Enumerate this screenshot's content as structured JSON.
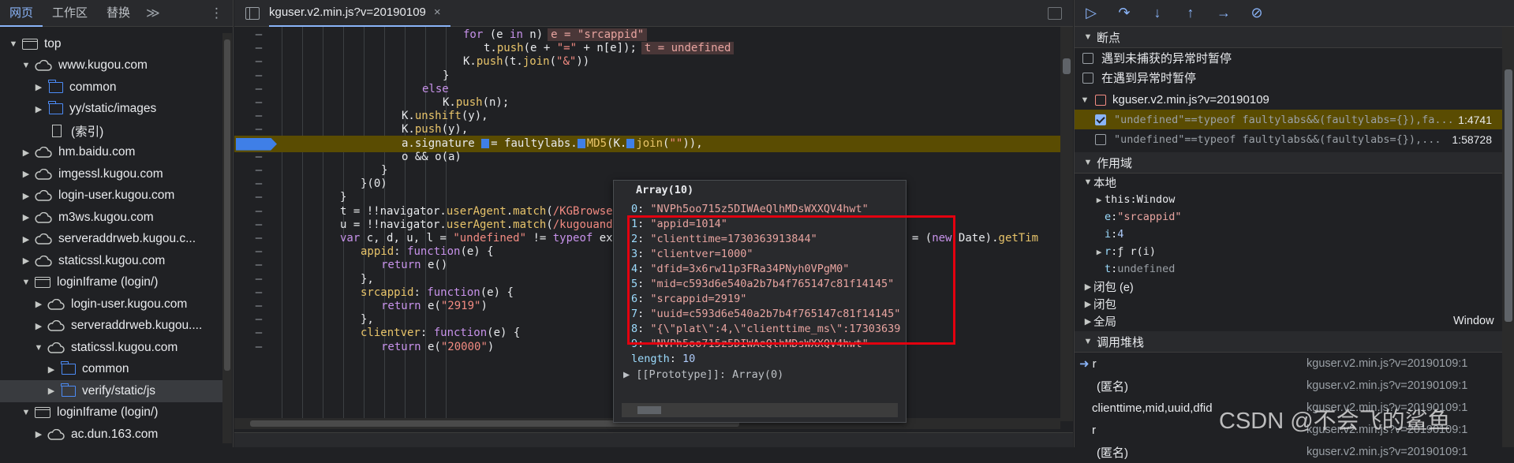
{
  "left_panel": {
    "tabs": [
      "网页",
      "工作区",
      "替换"
    ],
    "more_label": "≫",
    "menu_label": "⋮",
    "tree": [
      {
        "label": "top",
        "icon": "frame",
        "arrow": "▼",
        "depth": 0
      },
      {
        "label": "www.kugou.com",
        "icon": "cloud",
        "arrow": "▼",
        "depth": 1
      },
      {
        "label": "common",
        "icon": "folder",
        "arrow": "▶",
        "depth": 2
      },
      {
        "label": "yy/static/images",
        "icon": "folder",
        "arrow": "▶",
        "depth": 2
      },
      {
        "label": "(索引)",
        "icon": "file",
        "arrow": "",
        "depth": 2
      },
      {
        "label": "hm.baidu.com",
        "icon": "cloud",
        "arrow": "▶",
        "depth": 1
      },
      {
        "label": "imgessl.kugou.com",
        "icon": "cloud",
        "arrow": "▶",
        "depth": 1
      },
      {
        "label": "login-user.kugou.com",
        "icon": "cloud",
        "arrow": "▶",
        "depth": 1
      },
      {
        "label": "m3ws.kugou.com",
        "icon": "cloud",
        "arrow": "▶",
        "depth": 1
      },
      {
        "label": "serveraddrweb.kugou.c...",
        "icon": "cloud",
        "arrow": "▶",
        "depth": 1
      },
      {
        "label": "staticssl.kugou.com",
        "icon": "cloud",
        "arrow": "▶",
        "depth": 1
      },
      {
        "label": "loginIframe (login/)",
        "icon": "frame",
        "arrow": "▼",
        "depth": 1
      },
      {
        "label": "login-user.kugou.com",
        "icon": "cloud",
        "arrow": "▶",
        "depth": 2
      },
      {
        "label": "serveraddrweb.kugou....",
        "icon": "cloud",
        "arrow": "▶",
        "depth": 2
      },
      {
        "label": "staticssl.kugou.com",
        "icon": "cloud",
        "arrow": "▼",
        "depth": 2
      },
      {
        "label": "common",
        "icon": "folder",
        "arrow": "▶",
        "depth": 3
      },
      {
        "label": "verify/static/js",
        "icon": "folder",
        "arrow": "▶",
        "depth": 3,
        "selected": true
      },
      {
        "label": "loginIframe (login/)",
        "icon": "frame",
        "arrow": "▼",
        "depth": 1
      },
      {
        "label": "ac.dun.163.com",
        "icon": "cloud",
        "arrow": "▶",
        "depth": 2
      }
    ]
  },
  "editor": {
    "file_tab": "kguser.v2.min.js?v=20190109",
    "close_label": "×",
    "lines": [
      {
        "gutter": "–",
        "indent": 270,
        "html": "<span class='kw'>for</span> (e <span class='kw'>in</span> n)<span class='inl'>e = \"srcappid\"</span>"
      },
      {
        "gutter": "–",
        "indent": 296,
        "html": "t.<span class='prop'>push</span>(e + <span class='str'>\"=\"</span> + n[e]);<span class='inl'>t = undefined</span>"
      },
      {
        "gutter": "–",
        "indent": 270,
        "html": "K.<span class='prop'>push</span>(t.<span class='prop'>join</span>(<span class='str'>\"&amp;\"</span>))"
      },
      {
        "gutter": "–",
        "indent": 244,
        "html": "}"
      },
      {
        "gutter": "–",
        "indent": 218,
        "html": "<span class='kw'>else</span>"
      },
      {
        "gutter": "–",
        "indent": 244,
        "html": "K.<span class='prop'>push</span>(n);"
      },
      {
        "gutter": "–",
        "indent": 192,
        "html": "K.<span class='prop'>unshift</span>(y),"
      },
      {
        "gutter": "–",
        "indent": 192,
        "html": "K.<span class='prop'>push</span>(y),"
      },
      {
        "gutter": "",
        "indent": 192,
        "highlight": true,
        "html": "a.signature <span class='bpm'></span>= faultylabs.<span class='bpm'></span><span class='prop'>MD5</span>(K.<span class='bpm'></span><span class='prop'>join</span>(<span class='str'>\"\"</span>)),"
      },
      {
        "gutter": "–",
        "indent": 192,
        "html": "o &amp;&amp; o(a)"
      },
      {
        "gutter": "–",
        "indent": 166,
        "html": "}"
      },
      {
        "gutter": "–",
        "indent": 140,
        "html": "}(0)"
      },
      {
        "gutter": "–",
        "indent": 114,
        "html": "}"
      },
      {
        "gutter": "–",
        "indent": 114,
        "html": "t = !!navigator.<span class='prop'>userAgent</span>.<span class='prop'>match</span>(<span class='str'>/KGBrowser/</span>"
      },
      {
        "gutter": "–",
        "indent": 114,
        "html": "u = !!navigator.<span class='prop'>userAgent</span>.<span class='prop'>match</span>(<span class='str'>/kugouandro</span>"
      },
      {
        "gutter": "–",
        "indent": 114,
        "html": "<span class='kw'>var</span> c, d, u, l = <span class='str'>\"undefined\"</span> != <span class='kw'>typeof</span> ext                                       t, p = (<span class='kw'>new</span> Date).<span class='prop'>getTim</span>"
      },
      {
        "gutter": "–",
        "indent": 140,
        "html": "<span class='prop'>appid</span>: <span class='kw'>function</span>(e) {"
      },
      {
        "gutter": "–",
        "indent": 166,
        "html": "<span class='kw'>return</span> e()"
      },
      {
        "gutter": "–",
        "indent": 140,
        "html": "},"
      },
      {
        "gutter": "–",
        "indent": 140,
        "html": "<span class='prop'>srcappid</span>: <span class='kw'>function</span>(e) {"
      },
      {
        "gutter": "–",
        "indent": 166,
        "html": "<span class='kw'>return</span> e(<span class='str'>\"2919\"</span>)"
      },
      {
        "gutter": "–",
        "indent": 140,
        "html": "},"
      },
      {
        "gutter": "–",
        "indent": 140,
        "html": "<span class='prop'>clientver</span>: <span class='kw'>function</span>(e) {"
      },
      {
        "gutter": "–",
        "indent": 166,
        "html": "<span class='kw'>return</span> e(<span class='str'>\"20000\"</span>)"
      }
    ]
  },
  "popup": {
    "title": "Array(10)",
    "items": [
      {
        "key": "0",
        "value": "\"NVPh5oo715z5DIWAeQlhMDsWXXQV4hwt\""
      },
      {
        "key": "1",
        "value": "\"appid=1014\""
      },
      {
        "key": "2",
        "value": "\"clienttime=1730363913844\""
      },
      {
        "key": "3",
        "value": "\"clientver=1000\""
      },
      {
        "key": "4",
        "value": "\"dfid=3x6rw11p3FRa34PNyh0VPgM0\""
      },
      {
        "key": "5",
        "value": "\"mid=c593d6e540a2b7b4f765147c81f14145\""
      },
      {
        "key": "6",
        "value": "\"srcappid=2919\""
      },
      {
        "key": "7",
        "value": "\"uuid=c593d6e540a2b7b4f765147c81f14145\""
      },
      {
        "key": "8",
        "value": "\"{\\\"plat\\\":4,\\\"clienttime_ms\\\":17303639"
      },
      {
        "key": "9",
        "value": "\"NVPh5oo715z5DIWAeQlhMDsWXXQV4hwt\""
      }
    ],
    "length_key": "length",
    "length_value": "10",
    "prototype": "[[Prototype]]: Array(0)"
  },
  "debugger": {
    "breakpoints_title": "断点",
    "pause_uncaught": "遇到未捕获的异常时暂停",
    "pause_caught": "在遇到异常时暂停",
    "file": "kguser.v2.min.js?v=20190109",
    "breakpoints": [
      {
        "code": "\"undefined\"==typeof faultylabs&&(faultylabs={}),fa...",
        "line": "1:4741",
        "checked": true,
        "active": true
      },
      {
        "code": "\"undefined\"==typeof faultylabs&&(faultylabs={}),...",
        "line": "1:58728",
        "checked": false,
        "active": false
      }
    ],
    "scope_title": "作用域",
    "local_title": "本地",
    "scope_items": [
      {
        "arrow": "▶",
        "key": "this",
        "sep": ": ",
        "value": "Window",
        "kcolor": "#e8eaed",
        "vcolor": "#e8eaed"
      },
      {
        "arrow": "",
        "key": "e",
        "sep": ": ",
        "value": "\"srcappid\"",
        "kcolor": "#9cdcfe",
        "vcolor": "#e8a4a0"
      },
      {
        "arrow": "",
        "key": "i",
        "sep": ": ",
        "value": "4",
        "kcolor": "#9cdcfe",
        "vcolor": "#aecbfa"
      },
      {
        "arrow": "▶",
        "key": "r",
        "sep": ": ",
        "value": "ƒ r(i)",
        "kcolor": "#9cdcfe",
        "vcolor": "#e8eaed"
      },
      {
        "arrow": "",
        "key": "t",
        "sep": ": ",
        "value": "undefined",
        "kcolor": "#9cdcfe",
        "vcolor": "#9aa0a6"
      }
    ],
    "closure1": "闭包 (e)",
    "closure2": "闭包",
    "global_label": "全局",
    "global_value": "Window",
    "callstack_title": "调用堆栈",
    "stack": [
      {
        "name": "r",
        "loc": "kguser.v2.min.js?v=20190109:1",
        "current": true
      },
      {
        "name": "(匿名)",
        "loc": "kguser.v2.min.js?v=20190109:1",
        "current": false
      },
      {
        "name": "clienttime,mid,uuid,dfid",
        "loc": "kguser.v2.min.js?v=20190109:1",
        "current": false
      },
      {
        "name": "r",
        "loc": "kguser.v2.min.js?v=20190109:1",
        "current": false
      },
      {
        "name": "(匿名)",
        "loc": "kguser.v2.min.js?v=20190109:1",
        "current": false
      }
    ]
  },
  "watermark": "CSDN @不会飞的鲨鱼",
  "colors": {
    "accent": "#8ab4f8",
    "breakpoint": "#3f7fe7",
    "highlight_line": "#5a4c02",
    "annotation_box": "#e3000f"
  }
}
